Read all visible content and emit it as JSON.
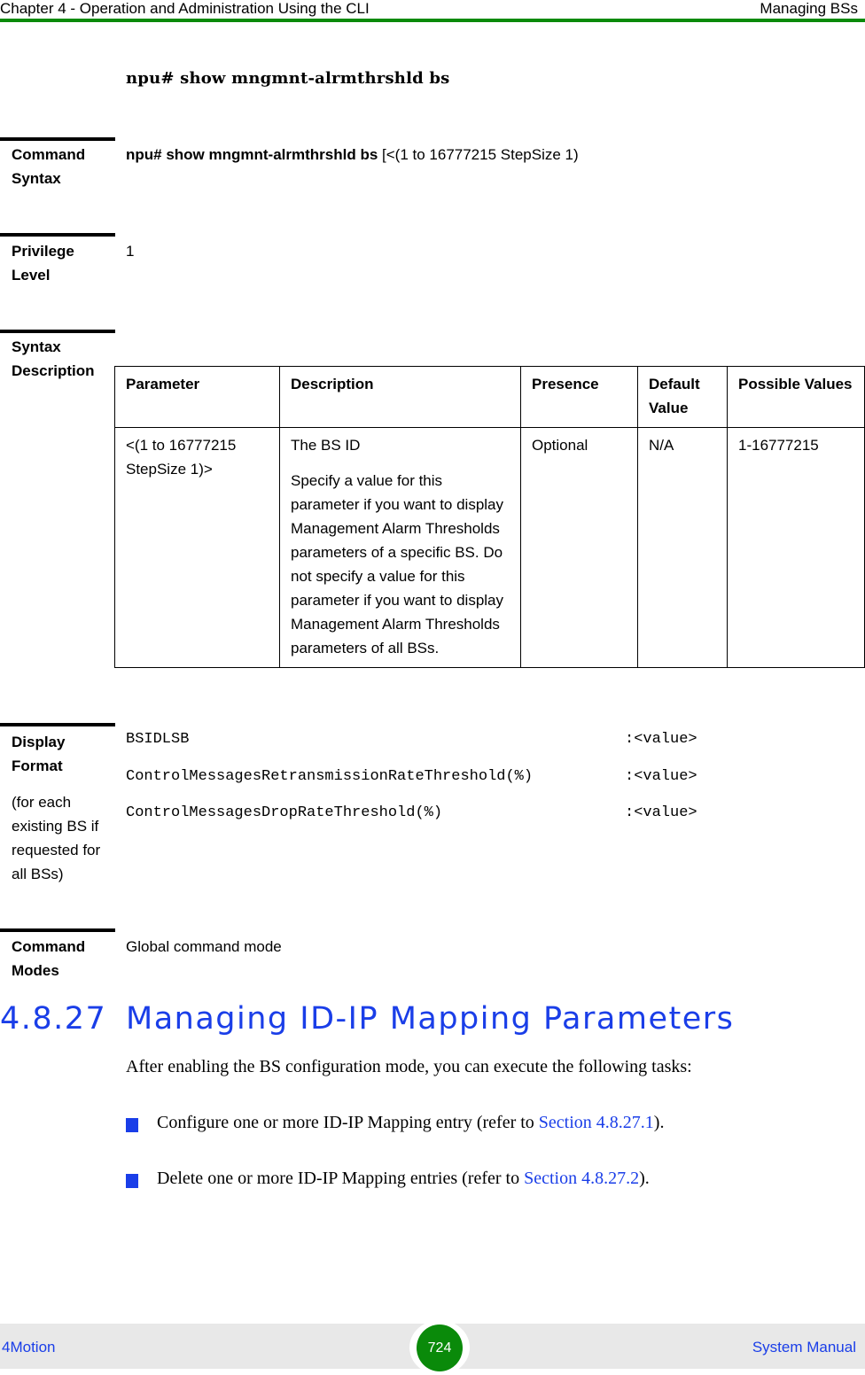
{
  "header": {
    "chapter": "Chapter 4 - Operation and Administration Using the CLI",
    "section": "Managing BSs"
  },
  "command_title": "npu# show mngmnt-alrmthrshld bs",
  "command_syntax": {
    "label_line1": "Command",
    "label_line2": "Syntax",
    "bold_part": "npu# show mngmnt-alrmthrshld bs",
    "normal_part": " [<(1 to 16777215 StepSize 1)"
  },
  "privilege_level": {
    "label_line1": "Privilege",
    "label_line2": "Level",
    "value": "1"
  },
  "syntax_description": {
    "label_line1": "Syntax",
    "label_line2": "Description",
    "columns": [
      "Parameter",
      "Description",
      "Presence",
      "Default Value",
      "Possible Values"
    ],
    "rows": [
      {
        "parameter": "<(1 to 16777215 StepSize 1)>",
        "description_title": "The BS ID",
        "description_body": "Specify a value for this parameter if you want to display Management Alarm Thresholds parameters of a specific BS. Do not specify a value for this parameter if you want to display Management Alarm Thresholds parameters of all BSs.",
        "presence": "Optional",
        "default_value": "N/A",
        "possible_values": "1-16777215"
      }
    ]
  },
  "display_format": {
    "label_line1": "Display",
    "label_line2": "Format",
    "sublabel": "(for each existing BS if requested for all BSs)",
    "lines": [
      {
        "key": "BSIDLSB",
        "value": ":<value>"
      },
      {
        "key": "ControlMessagesRetransmissionRateThreshold(%)",
        "value": ":<value>"
      },
      {
        "key": "ControlMessagesDropRateThreshold(%)",
        "value": ":<value>"
      }
    ]
  },
  "command_modes": {
    "label_line1": "Command",
    "label_line2": "Modes",
    "value": "Global command mode"
  },
  "section": {
    "number": "4.8.27",
    "title": "Managing ID-IP Mapping Parameters",
    "intro": "After enabling the BS configuration mode, you can execute the following tasks:",
    "bullets": [
      {
        "text_before": "Configure one or more ID-IP Mapping entry (refer to ",
        "link": "Section 4.8.27.1",
        "text_after": ")."
      },
      {
        "text_before": "Delete one or more ID-IP Mapping entries (refer to ",
        "link": "Section 4.8.27.2",
        "text_after": ")."
      }
    ]
  },
  "footer": {
    "left": "4Motion",
    "page_number": "724",
    "right": "System Manual"
  },
  "colors": {
    "header_rule": "#0a8a0a",
    "accent_blue": "#1a3ee8",
    "page_badge": "#0a8a0a",
    "footer_bg": "#e8e8e8"
  }
}
